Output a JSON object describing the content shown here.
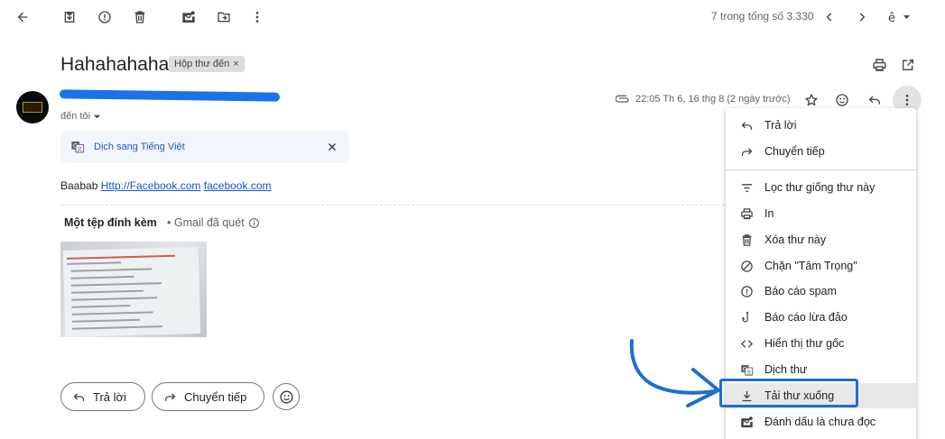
{
  "toolbar": {
    "back_icon": "arrow-back-icon",
    "archive_icon": "archive-icon",
    "spam_icon": "report-spam-icon",
    "delete_icon": "delete-icon",
    "mark_unread_icon": "mark-unread-icon",
    "move_icon": "move-to-icon",
    "more_icon": "more-vert-icon",
    "count_text": "7 trong tổng số 3.330",
    "input_tool_icon": "input-tools-icon"
  },
  "email": {
    "subject": "Hahahahaha",
    "label": "Hộp thư đến",
    "label_remove": "×",
    "to": "đến tôi",
    "date": "22:05 Th 6, 16 thg 8 (2 ngày trước)",
    "translate_link": "Dịch sang Tiếng Việt",
    "body_prefix": "Baabab",
    "links": [
      "Http://Facebook.com",
      "facebook.com"
    ]
  },
  "attachments": {
    "title": "Một tệp đính kèm",
    "scanned": "• Gmail đã quét"
  },
  "actions": {
    "reply": "Trả lời",
    "forward": "Chuyển tiếp"
  },
  "menu": {
    "items": [
      {
        "label": "Trả lời",
        "icon": "reply-icon"
      },
      {
        "label": "Chuyển tiếp",
        "icon": "forward-icon"
      },
      {
        "label": "Lọc thư giống thư này",
        "icon": "filter-icon"
      },
      {
        "label": "In",
        "icon": "print-icon"
      },
      {
        "label": "Xóa thư này",
        "icon": "delete-icon"
      },
      {
        "label": "Chặn \"Tâm Trọng\"",
        "icon": "block-icon"
      },
      {
        "label": "Báo cáo spam",
        "icon": "report-spam-icon"
      },
      {
        "label": "Báo cáo lừa đảo",
        "icon": "phishing-hook-icon"
      },
      {
        "label": "Hiển thị thư gốc",
        "icon": "code-icon"
      },
      {
        "label": "Dịch thư",
        "icon": "translate-icon"
      },
      {
        "label": "Tải thư xuống",
        "icon": "download-icon"
      },
      {
        "label": "Đánh dấu là chưa đọc",
        "icon": "mark-unread-icon"
      }
    ]
  },
  "colors": {
    "accent": "#1a73e8",
    "annotation": "#1f6fd0",
    "menu_highlight": "#e8e8e8"
  }
}
